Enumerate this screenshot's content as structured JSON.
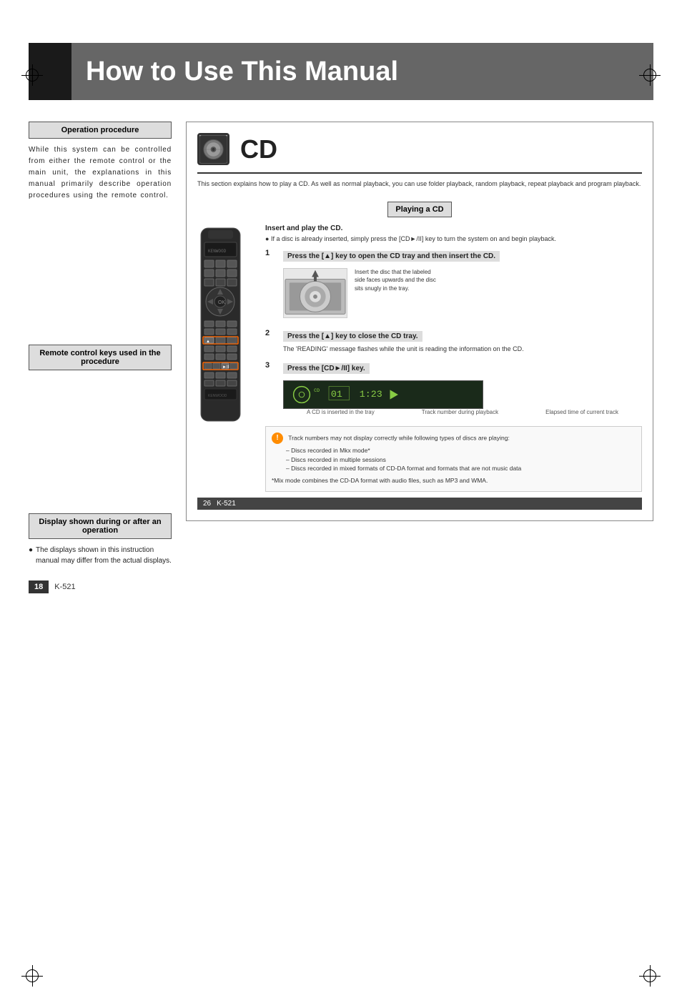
{
  "page": {
    "title": "How to Use This Manual",
    "page_number": "18",
    "model": "K-521"
  },
  "left_column": {
    "section1": {
      "box_label": "Operation procedure",
      "text": "While this system can be controlled from either the remote control or the main unit, the explanations in this manual primarily describe operation procedures using the remote control."
    },
    "section2": {
      "box_label": "Remote control keys used in the procedure"
    },
    "section3": {
      "box_label": "Display shown during or after an operation",
      "text": "The displays shown in this instruction manual may differ from the actual displays."
    }
  },
  "right_column": {
    "cd_section": {
      "icon": "CD disc icon",
      "title": "CD",
      "description": "This section explains how to play a CD. As well as normal playback, you can use folder playback, random playback, repeat playback and program playback.",
      "playing_box_label": "Playing a CD",
      "insert_title": "Insert and play the CD.",
      "insert_desc": "If a disc is already inserted, simply press the [CD►/II] key to turn the system on and begin playback.",
      "step1": {
        "num": "1",
        "instruction": "Press the [▲] key to open the CD tray and then insert the CD.",
        "note": "Insert the disc that the labeled side faces upwards and the disc sits snugly in the tray."
      },
      "step2": {
        "num": "2",
        "instruction": "Press the [▲] key to close the CD tray.",
        "note": "The 'READING' message flashes while the unit is reading the information on the CD."
      },
      "step3": {
        "num": "3",
        "instruction": "Press the [CD►/II] key."
      },
      "display_labels": {
        "label1": "A CD is inserted in the tray",
        "label2": "Track number during playback",
        "label3": "Elapsed time of current track"
      },
      "warning": {
        "items": [
          "Track numbers may not display correctly while following types of discs are playing:",
          "– Discs recorded in Mkx mode*",
          "– Discs recorded in multiple sessions",
          "– Discs recorded in mixed formats of CD-DA format and formats that are not music data",
          "*Mix mode combines the CD-DA format with audio files, such as MP3 and WMA."
        ]
      },
      "cd_page_number": "26",
      "cd_model": "K-521"
    }
  }
}
